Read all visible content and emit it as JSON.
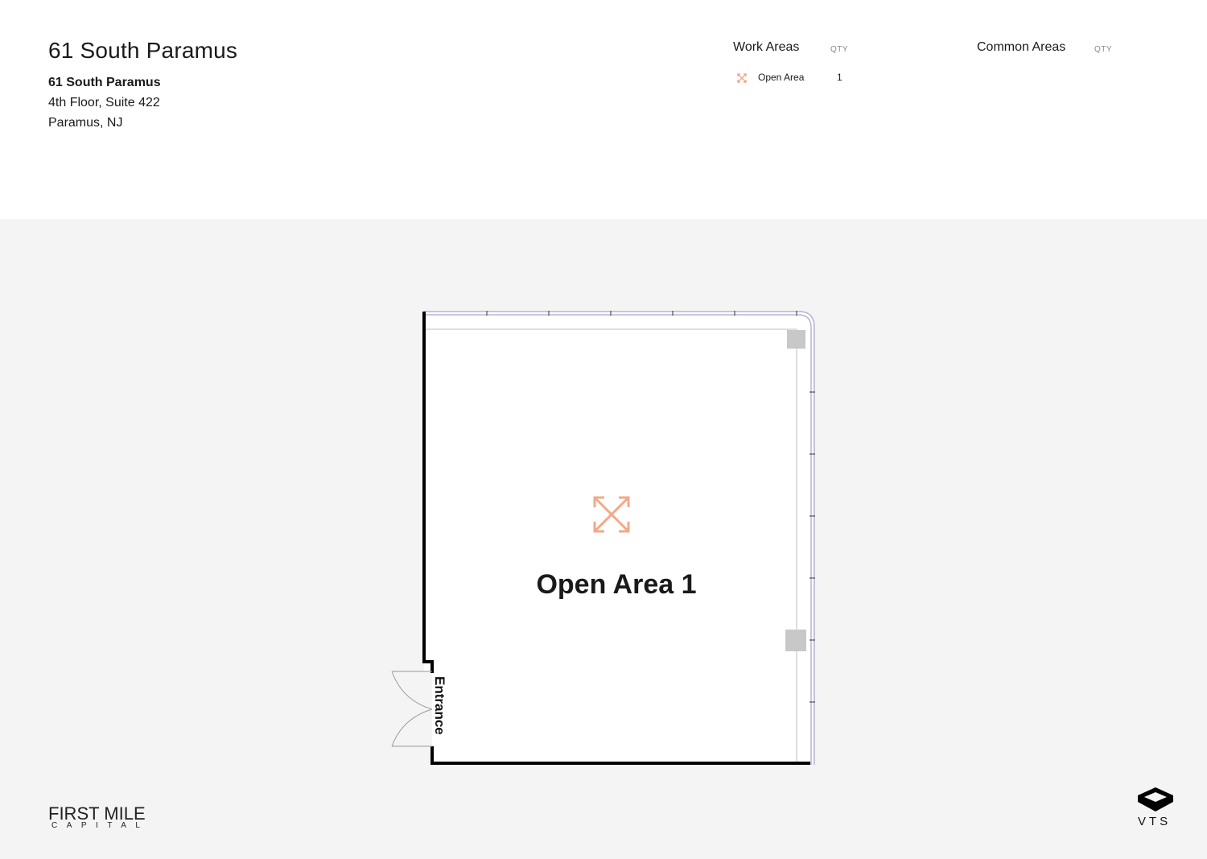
{
  "header": {
    "title": "61 South Paramus",
    "address": {
      "name": "61 South Paramus",
      "line1": "4th Floor, Suite 422",
      "line2": "Paramus, NJ"
    }
  },
  "legend": {
    "work_areas": {
      "heading": "Work Areas",
      "qty_label": "QTY",
      "items": [
        {
          "label": "Open Area",
          "qty": "1",
          "icon": "expand-arrows-icon"
        }
      ]
    },
    "common_areas": {
      "heading": "Common Areas",
      "qty_label": "QTY"
    }
  },
  "plan": {
    "room_label": "Open Area 1",
    "entrance_label": "Entrance",
    "room_icon": "expand-arrows-icon",
    "accent_color": "#f0a98a",
    "wall_color": "#000000",
    "window_color": "#b8b4d4",
    "column_color": "#c8c8c8"
  },
  "footer": {
    "brand_left_top": "FIRST MILE",
    "brand_left_bottom": "CAPITAL",
    "brand_right": "VTS"
  }
}
